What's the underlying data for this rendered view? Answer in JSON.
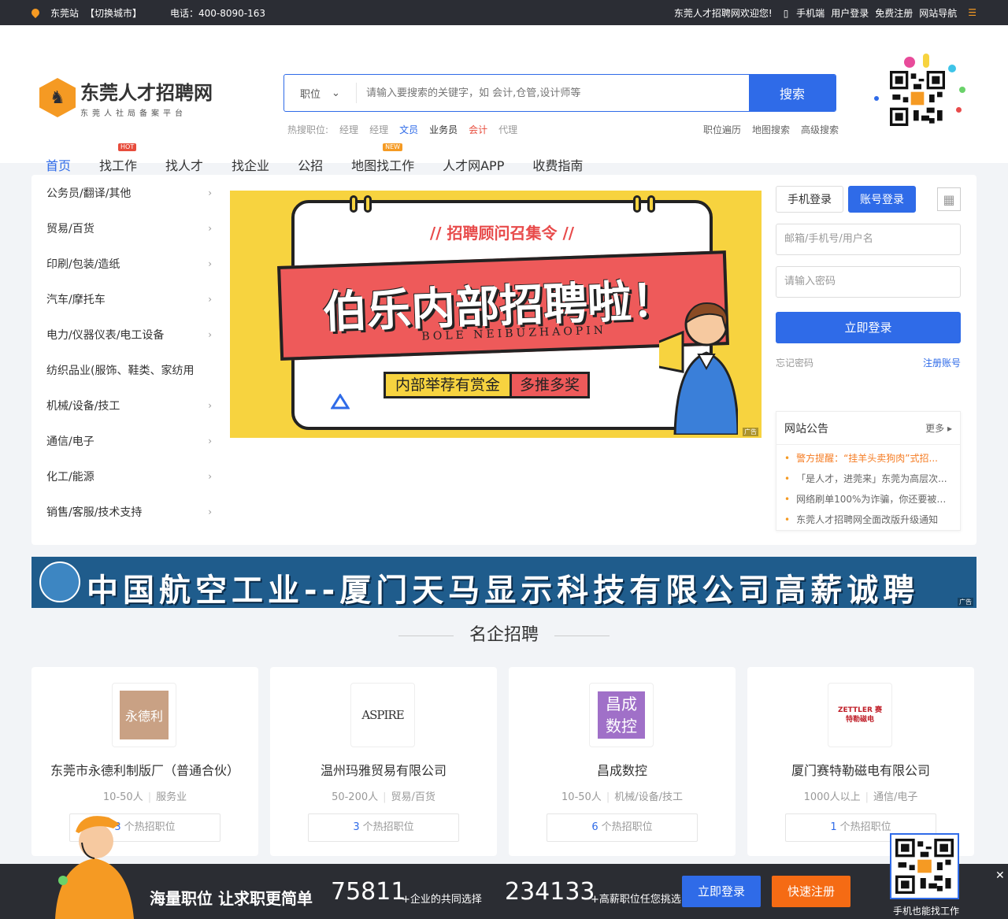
{
  "topbar": {
    "city": "东莞站",
    "switch_city": "【切换城市】",
    "phone": "电话：400-8090-163",
    "welcome": "东莞人才招聘网欢迎您!",
    "mobile": "手机端",
    "user_login": "用户登录",
    "free_register": "免费注册",
    "site_nav": "网站导航"
  },
  "header": {
    "logo_title": "东莞人才招聘网",
    "logo_subtitle": "东莞人社局备案平台",
    "search_type": "职位",
    "search_placeholder": "请输入要搜索的关键字，如 会计,仓管,设计师等",
    "search_button": "搜索",
    "hot_label": "热搜职位:",
    "hot_terms": [
      "经理",
      "经理",
      "文员",
      "业务员",
      "会计",
      "代理"
    ],
    "extra_links": [
      "职位遍历",
      "地图搜索",
      "高级搜索"
    ]
  },
  "nav": {
    "items": [
      {
        "label": "首页"
      },
      {
        "label": "找工作",
        "badge": "HOT"
      },
      {
        "label": "找人才"
      },
      {
        "label": "找企业"
      },
      {
        "label": "公招"
      },
      {
        "label": "地图找工作",
        "badge": "NEW"
      },
      {
        "label": "人才网APP"
      },
      {
        "label": "收费指南"
      }
    ]
  },
  "categories": [
    "公务员/翻译/其他",
    "贸易/百货",
    "印刷/包装/造纸",
    "汽车/摩托车",
    "电力/仪器仪表/电工设备",
    "纺织品业(服饰、鞋类、家纺用",
    "机械/设备/技工",
    "通信/电子",
    "化工/能源",
    "销售/客服/技术支持"
  ],
  "banner": {
    "headline": "// 招聘顾问召集令 //",
    "main_text": "伯乐内部招聘啦！",
    "english": "BOLE NEIBUZHAOPIN",
    "pill_left": "内部举荐有赏金",
    "pill_right": "多推多奖",
    "ad_tag": "广告"
  },
  "login": {
    "tab_mobile": "手机登录",
    "tab_account": "账号登录",
    "username_placeholder": "邮箱/手机号/用户名",
    "password_placeholder": "请输入密码",
    "login_button": "立即登录",
    "forgot": "忘记密码",
    "register": "注册账号"
  },
  "notice": {
    "title": "网站公告",
    "more": "更多",
    "items": [
      "警方提醒：“挂羊头卖狗肉”式招...",
      "「是人才，进莞来」东莞为高层次...",
      "网络刷单100%为诈骗，你还要被骗...",
      "东莞人才招聘网全面改版升级通知"
    ]
  },
  "ad_bar": {
    "text": "中国航空工业--厦门天马显示科技有限公司高薪诚聘",
    "ad_tag": "广告"
  },
  "section_title": "名企招聘",
  "companies": [
    {
      "logo_text": "永德利",
      "name": "东莞市永德利制版厂（普通合伙）",
      "size": "10-50人",
      "industry": "服务业",
      "jobs": "3",
      "jobs_label": "个热招职位"
    },
    {
      "logo_text": "ASPIRE",
      "name": "温州玛雅贸易有限公司",
      "size": "50-200人",
      "industry": "贸易/百货",
      "jobs": "3",
      "jobs_label": "个热招职位"
    },
    {
      "logo_text": "昌成数控",
      "name": "昌成数控",
      "size": "10-50人",
      "industry": "机械/设备/技工",
      "jobs": "6",
      "jobs_label": "个热招职位"
    },
    {
      "logo_text": "ZETTLER 赛特勒磁电",
      "name": "厦门赛特勒磁电有限公司",
      "size": "1000人以上",
      "industry": "通信/电子",
      "jobs": "1",
      "jobs_label": "个热招职位"
    }
  ],
  "bottom_bar": {
    "slogan": "海量职位 让求职更简单",
    "num1": "75811",
    "sub1": "+企业的共同选择",
    "num2": "234133",
    "sub2": "+高薪职位任您挑选",
    "login": "立即登录",
    "register": "快速注册",
    "qr_label": "手机也能找工作"
  },
  "colors": {
    "accent": "#2f6be8",
    "orange": "#f56b14",
    "topbar": "#2b2d34"
  }
}
